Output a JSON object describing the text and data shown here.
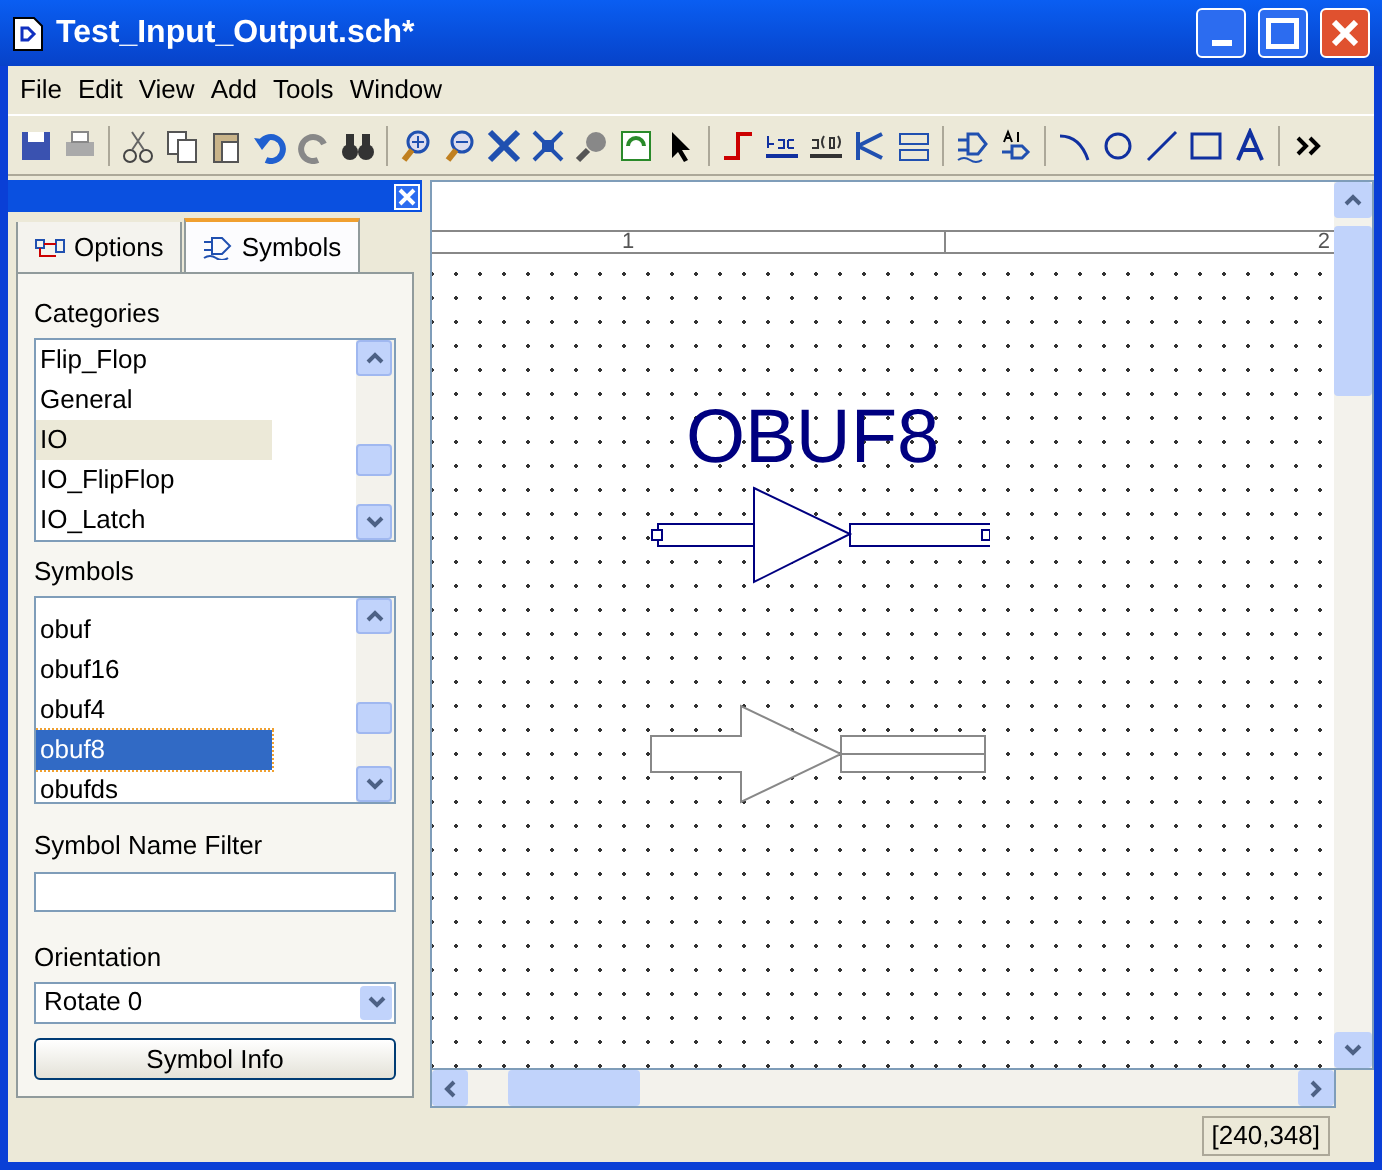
{
  "window": {
    "title": "Test_Input_Output.sch*"
  },
  "menu": [
    "File",
    "Edit",
    "View",
    "Add",
    "Tools",
    "Window"
  ],
  "panel": {
    "tabs": [
      {
        "label": "Options",
        "selected": false
      },
      {
        "label": "Symbols",
        "selected": true
      }
    ],
    "categories_label": "Categories",
    "categories": [
      {
        "label": "Flip_Flop",
        "selected": false
      },
      {
        "label": "General",
        "selected": false
      },
      {
        "label": "IO",
        "selected": true
      },
      {
        "label": "IO_FlipFlop",
        "selected": false
      },
      {
        "label": "IO_Latch",
        "selected": false
      }
    ],
    "symbols_label": "Symbols",
    "symbols": [
      {
        "label": "obuf",
        "selected": false
      },
      {
        "label": "obuf16",
        "selected": false
      },
      {
        "label": "obuf4",
        "selected": false
      },
      {
        "label": "obuf8",
        "selected": true
      },
      {
        "label": "obufds",
        "selected": false
      }
    ],
    "filter_label": "Symbol Name Filter",
    "orientation_label": "Orientation",
    "orientation": "Rotate 0",
    "info_button": "Symbol Info"
  },
  "canvas": {
    "ruler": [
      "1",
      "2"
    ],
    "symbol_name": "OBUF8"
  },
  "status_bar": {
    "coordinates": "[240,348]"
  }
}
